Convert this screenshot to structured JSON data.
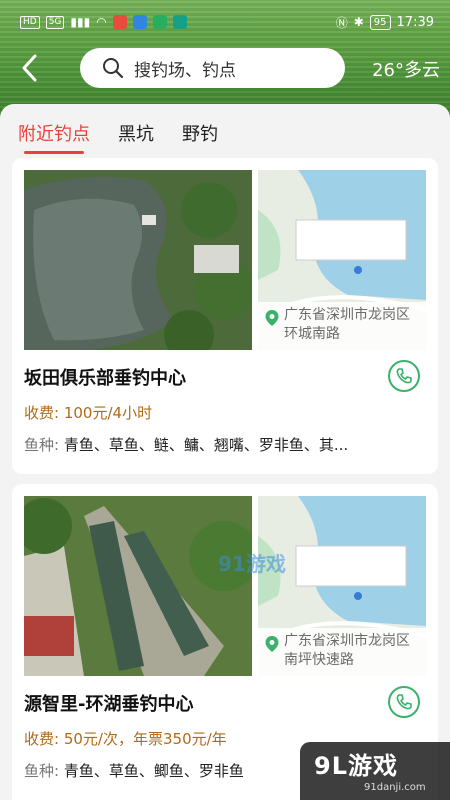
{
  "status_bar": {
    "chips": [
      "HD",
      "5G"
    ],
    "time": "17:39",
    "battery": "95",
    "icons": [
      "hd-icon",
      "signal-icon",
      "wifi-icon",
      "app-icon",
      "nfc-icon",
      "bluetooth-icon",
      "battery-icon"
    ]
  },
  "header": {
    "back_icon": "chevron-left-icon",
    "search_placeholder": "搜钓场、钓点",
    "search_icon": "search-icon",
    "weather": "26°多云"
  },
  "tabs": [
    {
      "label": "附近钓点",
      "active": true
    },
    {
      "label": "黑坑",
      "active": false
    },
    {
      "label": "野钓",
      "active": false
    }
  ],
  "spots": [
    {
      "name": "坂田俱乐部垂钓中心",
      "address": "广东省深圳市龙岗区环城南路",
      "fee_label": "收费:",
      "fee": "100元/4小时",
      "species_label": "鱼种:",
      "species": "青鱼、草鱼、鲢、鳙、翘嘴、罗非鱼、其..."
    },
    {
      "name": "源智里-环湖垂钓中心",
      "address": "广东省深圳市龙岗区南坪快速路",
      "fee_label": "收费:",
      "fee": "50元/次，年票350元/年",
      "species_label": "鱼种:",
      "species": "青鱼、草鱼、鲫鱼、罗非鱼"
    }
  ],
  "colors": {
    "accent": "#e8433b",
    "fee": "#b06a18",
    "phone": "#3ab26a"
  },
  "watermark": {
    "logo": "9L游戏",
    "site": "91danji.com",
    "overlay": "91游戏"
  }
}
